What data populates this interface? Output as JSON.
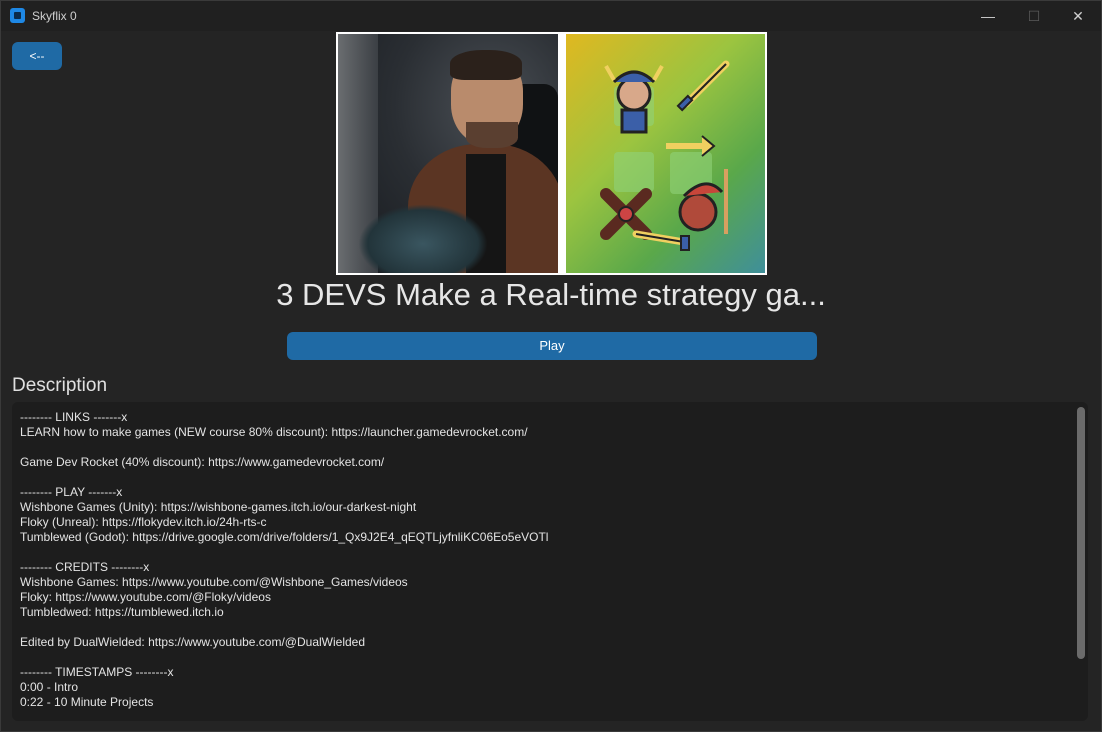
{
  "window": {
    "title": "Skyflix 0",
    "controls": {
      "minimize": "—",
      "maximize": "☐",
      "close": "✕"
    }
  },
  "back_button": {
    "label": "<--"
  },
  "video": {
    "title": "3 DEVS Make a Real-time strategy ga...",
    "play_label": "Play"
  },
  "description": {
    "heading": "Description",
    "lines": [
      "-------- LINKS -------x",
      "LEARN how to make games (NEW course 80% discount): https://launcher.gamedevrocket.com/",
      "",
      "Game Dev Rocket (40% discount): https://www.gamedevrocket.com/",
      "",
      "-------- PLAY -------x",
      "Wishbone Games (Unity): https://wishbone-games.itch.io/our-darkest-night",
      "Floky (Unreal): https://flokydev.itch.io/24h-rts-c",
      "Tumblewed (Godot): https://drive.google.com/drive/folders/1_Qx9J2E4_qEQTLjyfnliKC06Eo5eVOTl",
      "",
      "-------- CREDITS --------x",
      "Wishbone Games: https://www.youtube.com/@Wishbone_Games/videos",
      "Floky: https://www.youtube.com/@Floky/videos",
      "Tumbledwed: https://tumblewed.itch.io",
      "",
      "Edited by DualWielded: https://www.youtube.com/@DualWielded",
      "",
      "-------- TIMESTAMPS --------x",
      "0:00 - Intro",
      "0:22 - 10 Minute Projects"
    ]
  },
  "colors": {
    "accent": "#1f6aa5",
    "window_bg": "#242424",
    "textbox_bg": "#1d1d1d"
  }
}
